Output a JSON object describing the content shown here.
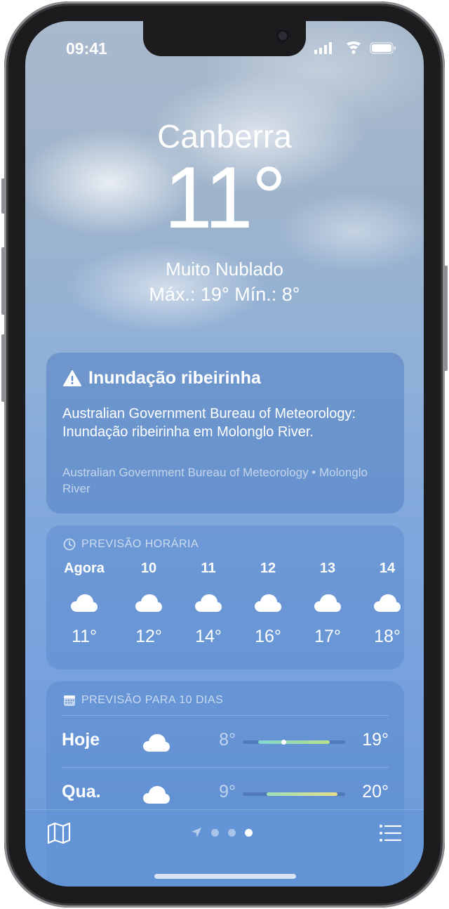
{
  "status_bar": {
    "time": "09:41"
  },
  "weather": {
    "city": "Canberra",
    "temperature": "11°",
    "condition": "Muito Nublado",
    "high_low": "Máx.: 19°  Mín.: 8°"
  },
  "alert": {
    "icon": "warning-icon",
    "title": "Inundação ribeirinha",
    "body": "Australian Government Bureau of Meteorology: Inundação ribeirinha em Molonglo River.",
    "source": "Australian Government Bureau of Meteorology • Molonglo River"
  },
  "hourly": {
    "header": "PREVISÃO HORÁRIA",
    "icon": "clock-icon",
    "items": [
      {
        "label": "Agora",
        "icon": "cloud-icon",
        "temp": "11°"
      },
      {
        "label": "10",
        "icon": "cloud-icon",
        "temp": "12°"
      },
      {
        "label": "11",
        "icon": "cloud-icon",
        "temp": "14°"
      },
      {
        "label": "12",
        "icon": "cloud-icon",
        "temp": "16°"
      },
      {
        "label": "13",
        "icon": "cloud-icon",
        "temp": "17°"
      },
      {
        "label": "14",
        "icon": "cloud-icon",
        "temp": "18°"
      }
    ]
  },
  "daily": {
    "header": "PREVISÃO PARA 10 DIAS",
    "icon": "calendar-icon",
    "days": [
      {
        "name": "Hoje",
        "icon": "cloud-icon",
        "low": "8°",
        "high": "19°",
        "range_start": 0.15,
        "range_end": 0.85,
        "current": 0.4,
        "gradient": [
          "#7fd6d0",
          "#b7e08a"
        ]
      },
      {
        "name": "Qua.",
        "icon": "cloud-icon",
        "low": "9°",
        "high": "20°",
        "range_start": 0.23,
        "range_end": 0.92,
        "gradient": [
          "#9fe0b8",
          "#e6e08a"
        ]
      }
    ]
  },
  "toolbar": {
    "map_icon": "map-icon",
    "list_icon": "list-icon",
    "location_icon": "location-arrow-icon",
    "pages": 3,
    "active_page": 3
  },
  "colors": {
    "screen_top": "#a9b9cc",
    "screen_bottom": "#6b9ad8",
    "text": "#ffffff"
  }
}
